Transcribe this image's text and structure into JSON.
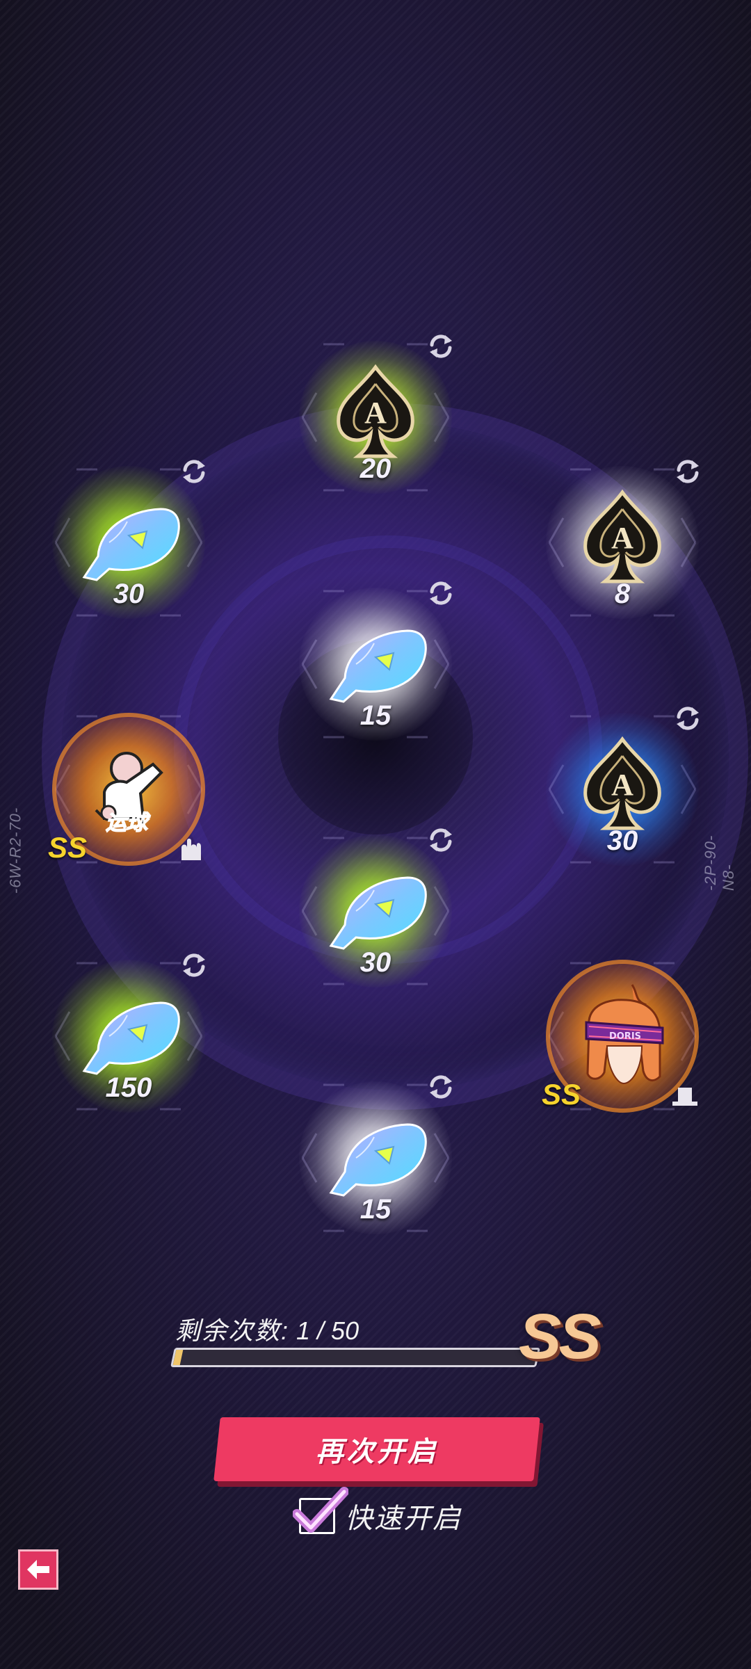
{
  "grid": {
    "tiles": [
      {
        "id": "top",
        "item": "spade-ace",
        "count": "20",
        "glow": "#c6ff2a"
      },
      {
        "id": "left-1",
        "item": "fish",
        "count": "30",
        "glow": "#b8ff22"
      },
      {
        "id": "right-1",
        "item": "spade-ace",
        "count": "8",
        "glow": "#ffffff"
      },
      {
        "id": "center-1",
        "item": "fish",
        "count": "15",
        "glow": "#ffffff"
      },
      {
        "id": "left-2",
        "item": "character-card",
        "label": "运球",
        "grade": "SS",
        "glow": "#ff9a1a"
      },
      {
        "id": "right-2",
        "item": "spade-ace",
        "count": "30",
        "glow": "#2a8cff"
      },
      {
        "id": "center-2",
        "item": "fish",
        "count": "30",
        "glow": "#b8ff22"
      },
      {
        "id": "left-3",
        "item": "fish",
        "count": "150",
        "glow": "#b8ff22"
      },
      {
        "id": "right-3",
        "item": "character-head",
        "label": "DORIS",
        "grade": "SS",
        "glow": "#ff9a1a"
      },
      {
        "id": "bottom",
        "item": "fish",
        "count": "15",
        "glow": "#ffffff"
      }
    ],
    "side_codes": {
      "left": "-6W-R2-70-",
      "right": "-2P-90-N8-"
    }
  },
  "progress": {
    "label": "剩余次数:",
    "value_text": "1 / 50",
    "fraction": 0.02,
    "grade": "SS"
  },
  "actions": {
    "reopen_label": "再次开启",
    "quick_open_label": "快速开启",
    "quick_open_checked": true
  },
  "icons": {
    "back": "back-arrow-icon",
    "refresh": "refresh-icon",
    "check": "checkmark-icon"
  },
  "colors": {
    "accent_pink": "#ee3a62",
    "grade_yellow": "#f6d32d",
    "progress_fill": "#f0c56a"
  }
}
